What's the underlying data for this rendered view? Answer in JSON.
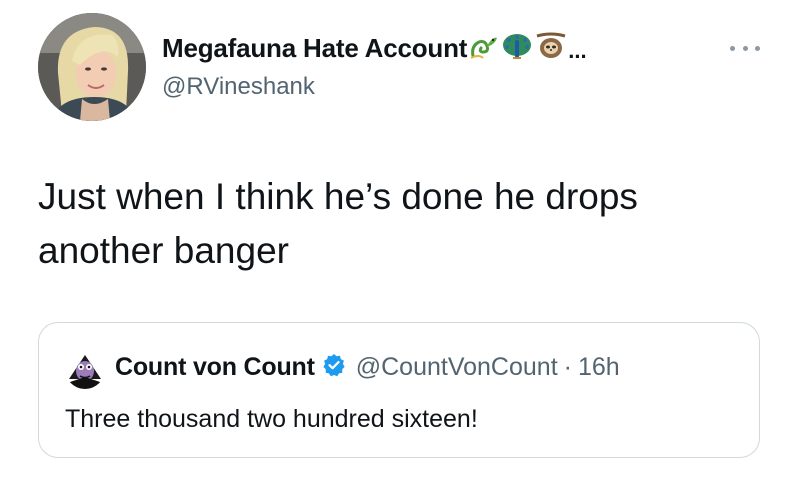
{
  "author": {
    "display_name": "Megafauna Hate Account",
    "name_emojis": [
      "dragon-icon",
      "peacock-icon",
      "sloth-icon"
    ],
    "name_truncation": "...",
    "handle": "@RVineshank"
  },
  "tweet": {
    "text": "Just when I think he’s done he drops another banger"
  },
  "quoted_tweet": {
    "display_name": "Count von Count",
    "verified": true,
    "handle": "@CountVonCount",
    "separator": "·",
    "time": "16h",
    "text": "Three thousand two hundred sixteen!"
  },
  "colors": {
    "text_primary": "#0f1419",
    "text_secondary": "#536471",
    "border": "#cfd9de",
    "verified_blue": "#1d9bf0"
  }
}
